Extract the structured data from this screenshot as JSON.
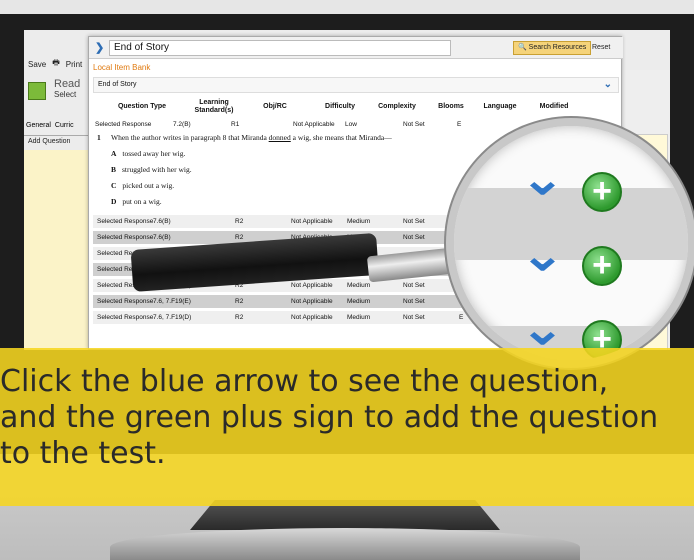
{
  "toolbar": {
    "save_label": "Save",
    "print_label": "Print"
  },
  "background": {
    "read_label": "Read",
    "select_label": "Select",
    "tab_general": "General",
    "tab_curric": "Curric",
    "add_question": "Add Question"
  },
  "dialog": {
    "title": "End of Story",
    "search_label": "Search Resources",
    "reset_label": "Reset",
    "library_label": "Local Item Bank",
    "story_label": "End of Story",
    "columns": [
      "Question Type",
      "Learning Standard(s)",
      "Obj/RC",
      "Difficulty",
      "Complexity",
      "Blooms",
      "Language",
      "Modified"
    ],
    "first_row": {
      "type": "Selected Response",
      "standard": "7.2(B)",
      "obj": "R1",
      "difficulty": "Not Applicable",
      "complexity": "Low",
      "blooms": "Not Set",
      "language": "E"
    },
    "question": {
      "number": "1",
      "stem_pre": "When the author writes in paragraph 8 that Miranda ",
      "stem_underline": "donned",
      "stem_post": " a wig, she means that Miranda—",
      "answers": [
        {
          "letter": "A",
          "text": "tossed away her wig."
        },
        {
          "letter": "B",
          "text": "struggled with her wig."
        },
        {
          "letter": "C",
          "text": "picked out a wig."
        },
        {
          "letter": "D",
          "text": "put on a wig."
        }
      ]
    },
    "rows": [
      {
        "type": "Selected Response",
        "standard": "7.6(B)",
        "obj": "R2",
        "difficulty": "Not Applicable",
        "complexity": "Medium",
        "blooms": "Not Set",
        "language": ""
      },
      {
        "type": "Selected Response",
        "standard": "7.6(B)",
        "obj": "R2",
        "difficulty": "Not Applicable",
        "complexity": "Medium",
        "blooms": "Not Set",
        "language": ""
      },
      {
        "type": "Selected Resp",
        "standard": "",
        "obj": "",
        "difficulty": "",
        "complexity": "",
        "blooms": "",
        "language": ""
      },
      {
        "type": "Selected Resp",
        "standard": "",
        "obj": "",
        "difficulty": "",
        "complexity": "",
        "blooms": "Not Set",
        "language": ""
      },
      {
        "type": "Selected Response",
        "standard": "7.6, 7.F19(D)",
        "obj": "R2",
        "difficulty": "Not Applicable",
        "complexity": "Medium",
        "blooms": "Not Set",
        "language": "E"
      },
      {
        "type": "Selected Response",
        "standard": "7.6, 7.F19(E)",
        "obj": "R2",
        "difficulty": "Not Applicable",
        "complexity": "Medium",
        "blooms": "Not Set",
        "language": "E"
      },
      {
        "type": "Selected Response",
        "standard": "7.6, 7.F19(D)",
        "obj": "R2",
        "difficulty": "Not Applicable",
        "complexity": "Medium",
        "blooms": "Not Set",
        "language": "E"
      }
    ]
  },
  "caption": "Click the blue arrow to see the question,\nand the green plus sign to add the question\nto the test.",
  "colors": {
    "accent_blue": "#2f77c9",
    "accent_green": "#3aa73a",
    "caption_yellow": "#f6d620",
    "library_orange": "#e07a10"
  },
  "icons": {
    "expand": "chevron-down-icon",
    "add": "plus-circle-icon",
    "search": "search-icon",
    "print": "printer-icon"
  }
}
